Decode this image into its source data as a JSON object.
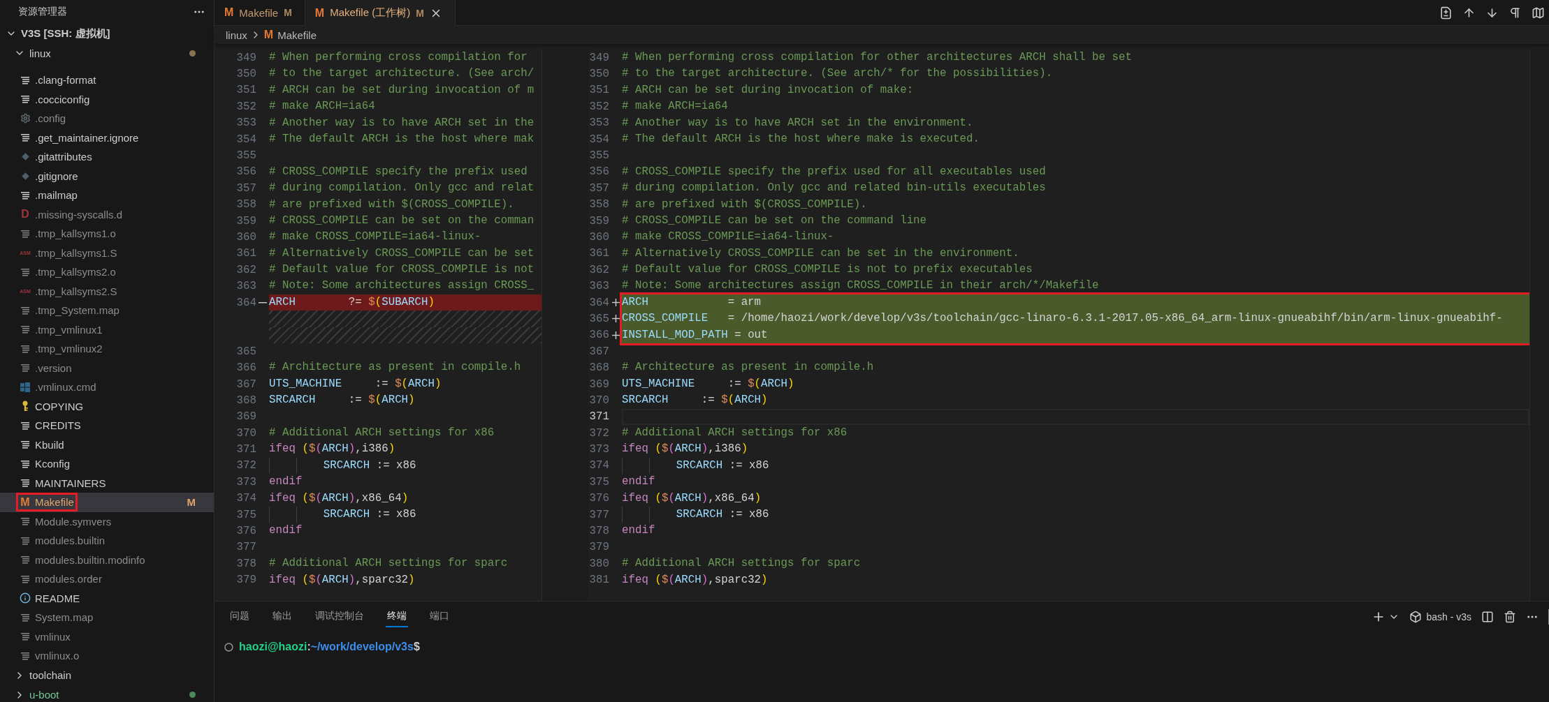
{
  "sidebar": {
    "title": "资源管理器",
    "workspace": {
      "label": "V3S [SSH: 虚拟机]",
      "expanded": true
    },
    "folders": [
      {
        "name": "linux",
        "expanded": true,
        "untracked": false,
        "color": "#8c7251",
        "files": [
          {
            "name": ".clang-format",
            "kind": "lines",
            "ignored": false,
            "modified": false,
            "selected": false,
            "annotated": false
          },
          {
            "name": ".cocciconfig",
            "kind": "lines",
            "ignored": false,
            "modified": false,
            "selected": false,
            "annotated": false
          },
          {
            "name": ".config",
            "kind": "gear",
            "ignored": true,
            "modified": false,
            "selected": false,
            "annotated": false
          },
          {
            "name": ".get_maintainer.ignore",
            "kind": "lines",
            "ignored": false,
            "modified": false,
            "selected": false,
            "annotated": false
          },
          {
            "name": ".gitattributes",
            "kind": "git",
            "ignored": false,
            "modified": false,
            "selected": false,
            "annotated": false
          },
          {
            "name": ".gitignore",
            "kind": "git",
            "ignored": false,
            "modified": false,
            "selected": false,
            "annotated": false
          },
          {
            "name": ".mailmap",
            "kind": "lines",
            "ignored": false,
            "modified": false,
            "selected": false,
            "annotated": false
          },
          {
            "name": ".missing-syscalls.d",
            "kind": "dep",
            "icon_text": "D",
            "ignored": true,
            "modified": false,
            "selected": false,
            "annotated": false
          },
          {
            "name": ".tmp_kallsyms1.o",
            "kind": "lines",
            "ignored": true,
            "modified": false,
            "selected": false,
            "annotated": false
          },
          {
            "name": ".tmp_kallsyms1.S",
            "kind": "asm",
            "icon_text": "ASM",
            "ignored": true,
            "modified": false,
            "selected": false,
            "annotated": false
          },
          {
            "name": ".tmp_kallsyms2.o",
            "kind": "lines",
            "ignored": true,
            "modified": false,
            "selected": false,
            "annotated": false
          },
          {
            "name": ".tmp_kallsyms2.S",
            "kind": "asm",
            "icon_text": "ASM",
            "ignored": true,
            "modified": false,
            "selected": false,
            "annotated": false
          },
          {
            "name": ".tmp_System.map",
            "kind": "lines",
            "ignored": true,
            "modified": false,
            "selected": false,
            "annotated": false
          },
          {
            "name": ".tmp_vmlinux1",
            "kind": "lines",
            "ignored": true,
            "modified": false,
            "selected": false,
            "annotated": false
          },
          {
            "name": ".tmp_vmlinux2",
            "kind": "lines",
            "ignored": true,
            "modified": false,
            "selected": false,
            "annotated": false
          },
          {
            "name": ".version",
            "kind": "lines",
            "ignored": true,
            "modified": false,
            "selected": false,
            "annotated": false
          },
          {
            "name": ".vmlinux.cmd",
            "kind": "windows",
            "ignored": true,
            "modified": false,
            "selected": false,
            "annotated": false
          },
          {
            "name": "COPYING",
            "kind": "key",
            "ignored": false,
            "modified": false,
            "selected": false,
            "annotated": false
          },
          {
            "name": "CREDITS",
            "kind": "lines",
            "ignored": false,
            "modified": false,
            "selected": false,
            "annotated": false
          },
          {
            "name": "Kbuild",
            "kind": "lines",
            "ignored": false,
            "modified": false,
            "selected": false,
            "annotated": false
          },
          {
            "name": "Kconfig",
            "kind": "lines",
            "ignored": false,
            "modified": false,
            "selected": false,
            "annotated": false
          },
          {
            "name": "MAINTAINERS",
            "kind": "lines",
            "ignored": false,
            "modified": false,
            "selected": false,
            "annotated": false
          },
          {
            "name": "Makefile",
            "kind": "make",
            "icon_text": "M",
            "ignored": false,
            "modified": true,
            "selected": true,
            "annotated": true,
            "badge": "M"
          },
          {
            "name": "Module.symvers",
            "kind": "lines",
            "ignored": true,
            "modified": false,
            "selected": false,
            "annotated": false
          },
          {
            "name": "modules.builtin",
            "kind": "lines",
            "ignored": true,
            "modified": false,
            "selected": false,
            "annotated": false
          },
          {
            "name": "modules.builtin.modinfo",
            "kind": "lines",
            "ignored": true,
            "modified": false,
            "selected": false,
            "annotated": false
          },
          {
            "name": "modules.order",
            "kind": "lines",
            "ignored": true,
            "modified": false,
            "selected": false,
            "annotated": false
          },
          {
            "name": "README",
            "kind": "info",
            "ignored": false,
            "modified": false,
            "selected": false,
            "annotated": false
          },
          {
            "name": "System.map",
            "kind": "lines",
            "ignored": true,
            "modified": false,
            "selected": false,
            "annotated": false
          },
          {
            "name": "vmlinux",
            "kind": "lines",
            "ignored": true,
            "modified": false,
            "selected": false,
            "annotated": false
          },
          {
            "name": "vmlinux.o",
            "kind": "lines",
            "ignored": true,
            "modified": false,
            "selected": false,
            "annotated": false
          }
        ]
      },
      {
        "name": "toolchain",
        "expanded": false,
        "untracked": false
      },
      {
        "name": "u-boot",
        "expanded": false,
        "untracked": true,
        "color": "#4b8a5a"
      }
    ]
  },
  "tabs": [
    {
      "label": "Makefile",
      "icon_text": "M",
      "badge": "M",
      "modified": true,
      "selected": false
    },
    {
      "label": "Makefile (工作树)",
      "icon_text": "M",
      "badge": "M",
      "modified": true,
      "selected": true
    }
  ],
  "breadcrumb": [
    {
      "label": "linux"
    },
    {
      "label": "Makefile",
      "icon_text": "M"
    }
  ],
  "diff": {
    "left": {
      "lines": [
        {
          "number": "349",
          "tokens": [
            {
              "text": "# When performing cross compilation for",
              "kind": "comment"
            }
          ]
        },
        {
          "number": "350",
          "tokens": [
            {
              "text": "# to the target architecture. (See arch/",
              "kind": "comment"
            }
          ]
        },
        {
          "number": "351",
          "tokens": [
            {
              "text": "# ARCH can be set during invocation of m",
              "kind": "comment"
            }
          ]
        },
        {
          "number": "352",
          "tokens": [
            {
              "text": "# make ARCH=ia64",
              "kind": "comment"
            }
          ]
        },
        {
          "number": "353",
          "tokens": [
            {
              "text": "# Another way is to have ARCH set in the",
              "kind": "comment"
            }
          ]
        },
        {
          "number": "354",
          "tokens": [
            {
              "text": "# The default ARCH is the host where mak",
              "kind": "comment"
            }
          ]
        },
        {
          "number": "355"
        },
        {
          "number": "356",
          "tokens": [
            {
              "text": "# CROSS_COMPILE specify the prefix used",
              "kind": "comment"
            }
          ]
        },
        {
          "number": "357",
          "tokens": [
            {
              "text": "# during compilation. Only gcc and relat",
              "kind": "comment"
            }
          ]
        },
        {
          "number": "358",
          "tokens": [
            {
              "text": "# are prefixed with $(CROSS_COMPILE).",
              "kind": "comment"
            }
          ]
        },
        {
          "number": "359",
          "tokens": [
            {
              "text": "# CROSS_COMPILE can be set on the comman",
              "kind": "comment"
            }
          ]
        },
        {
          "number": "360",
          "tokens": [
            {
              "text": "# make CROSS_COMPILE=ia64-linux-",
              "kind": "comment"
            }
          ]
        },
        {
          "number": "361",
          "tokens": [
            {
              "text": "# Alternatively CROSS_COMPILE can be set",
              "kind": "comment"
            }
          ]
        },
        {
          "number": "362",
          "tokens": [
            {
              "text": "# Default value for CROSS_COMPILE is not",
              "kind": "comment"
            }
          ]
        },
        {
          "number": "363",
          "tokens": [
            {
              "text": "# Note: Some architectures assign CROSS_",
              "kind": "comment"
            }
          ]
        },
        {
          "number": "364",
          "removed": true,
          "tokens": [
            {
              "text": "ARCH",
              "kind": "name"
            },
            {
              "text": "        ?= ",
              "kind": "plain"
            },
            {
              "text": "$",
              "kind": "dollar"
            },
            {
              "text": "(",
              "kind": "paren"
            },
            {
              "text": "SUBARCH",
              "kind": "name"
            },
            {
              "text": ")",
              "kind": "paren"
            }
          ]
        },
        {
          "kind": "filler"
        },
        {
          "kind": "filler"
        },
        {
          "number": "365"
        },
        {
          "number": "366",
          "tokens": [
            {
              "text": "# Architecture as present in compile.h",
              "kind": "comment"
            }
          ]
        },
        {
          "number": "367",
          "tokens": [
            {
              "text": "UTS_MACHINE",
              "kind": "name"
            },
            {
              "text": "     := ",
              "kind": "plain"
            },
            {
              "text": "$",
              "kind": "dollar"
            },
            {
              "text": "(",
              "kind": "paren"
            },
            {
              "text": "ARCH",
              "kind": "name"
            },
            {
              "text": ")",
              "kind": "paren"
            }
          ]
        },
        {
          "number": "368",
          "tokens": [
            {
              "text": "SRCARCH",
              "kind": "name"
            },
            {
              "text": "     := ",
              "kind": "plain"
            },
            {
              "text": "$",
              "kind": "dollar"
            },
            {
              "text": "(",
              "kind": "paren"
            },
            {
              "text": "ARCH",
              "kind": "name"
            },
            {
              "text": ")",
              "kind": "paren"
            }
          ]
        },
        {
          "number": "369"
        },
        {
          "number": "370",
          "tokens": [
            {
              "text": "# Additional ARCH settings for x86",
              "kind": "comment"
            }
          ]
        },
        {
          "number": "371",
          "tokens": [
            {
              "text": "ifeq ",
              "kind": "keyword"
            },
            {
              "text": "(",
              "kind": "paren"
            },
            {
              "text": "$",
              "kind": "dollar"
            },
            {
              "text": "(",
              "kind": "paren2"
            },
            {
              "text": "ARCH",
              "kind": "name"
            },
            {
              "text": ")",
              "kind": "paren2"
            },
            {
              "text": ",i386",
              "kind": "plain"
            },
            {
              "text": ")",
              "kind": "paren"
            }
          ]
        },
        {
          "number": "372",
          "tokens": [
            {
              "kind": "tab"
            },
            {
              "kind": "tab"
            },
            {
              "text": "SRCARCH",
              "kind": "name"
            },
            {
              "text": " := x86",
              "kind": "plain"
            }
          ]
        },
        {
          "number": "373",
          "tokens": [
            {
              "text": "endif",
              "kind": "keyword"
            }
          ]
        },
        {
          "number": "374",
          "tokens": [
            {
              "text": "ifeq ",
              "kind": "keyword"
            },
            {
              "text": "(",
              "kind": "paren"
            },
            {
              "text": "$",
              "kind": "dollar"
            },
            {
              "text": "(",
              "kind": "paren2"
            },
            {
              "text": "ARCH",
              "kind": "name"
            },
            {
              "text": ")",
              "kind": "paren2"
            },
            {
              "text": ",x86_64",
              "kind": "plain"
            },
            {
              "text": ")",
              "kind": "paren"
            }
          ]
        },
        {
          "number": "375",
          "tokens": [
            {
              "kind": "tab"
            },
            {
              "kind": "tab"
            },
            {
              "text": "SRCARCH",
              "kind": "name"
            },
            {
              "text": " := x86",
              "kind": "plain"
            }
          ]
        },
        {
          "number": "376",
          "tokens": [
            {
              "text": "endif",
              "kind": "keyword"
            }
          ]
        },
        {
          "number": "377"
        },
        {
          "number": "378",
          "tokens": [
            {
              "text": "# Additional ARCH settings for sparc",
              "kind": "comment"
            }
          ]
        },
        {
          "number": "379",
          "tokens": [
            {
              "text": "ifeq ",
              "kind": "keyword"
            },
            {
              "text": "(",
              "kind": "paren"
            },
            {
              "text": "$",
              "kind": "dollar"
            },
            {
              "text": "(",
              "kind": "paren2"
            },
            {
              "text": "ARCH",
              "kind": "name"
            },
            {
              "text": ")",
              "kind": "paren2"
            },
            {
              "text": ",sparc32",
              "kind": "plain"
            },
            {
              "text": ")",
              "kind": "paren"
            }
          ]
        }
      ]
    },
    "right": {
      "lines": [
        {
          "number": "349",
          "tokens": [
            {
              "text": "# When performing cross compilation for other architectures ARCH shall be set",
              "kind": "comment"
            }
          ]
        },
        {
          "number": "350",
          "tokens": [
            {
              "text": "# to the target architecture. (See arch/* for the possibilities).",
              "kind": "comment"
            }
          ]
        },
        {
          "number": "351",
          "tokens": [
            {
              "text": "# ARCH can be set during invocation of make:",
              "kind": "comment"
            }
          ]
        },
        {
          "number": "352",
          "tokens": [
            {
              "text": "# make ARCH=ia64",
              "kind": "comment"
            }
          ]
        },
        {
          "number": "353",
          "tokens": [
            {
              "text": "# Another way is to have ARCH set in the environment.",
              "kind": "comment"
            }
          ]
        },
        {
          "number": "354",
          "tokens": [
            {
              "text": "# The default ARCH is the host where make is executed.",
              "kind": "comment"
            }
          ]
        },
        {
          "number": "355"
        },
        {
          "number": "356",
          "tokens": [
            {
              "text": "# CROSS_COMPILE specify the prefix used for all executables used",
              "kind": "comment"
            }
          ]
        },
        {
          "number": "357",
          "tokens": [
            {
              "text": "# during compilation. Only gcc and related bin-utils executables",
              "kind": "comment"
            }
          ]
        },
        {
          "number": "358",
          "tokens": [
            {
              "text": "# are prefixed with $(CROSS_COMPILE).",
              "kind": "comment"
            }
          ]
        },
        {
          "number": "359",
          "tokens": [
            {
              "text": "# CROSS_COMPILE can be set on the command line",
              "kind": "comment"
            }
          ]
        },
        {
          "number": "360",
          "tokens": [
            {
              "text": "# make CROSS_COMPILE=ia64-linux-",
              "kind": "comment"
            }
          ]
        },
        {
          "number": "361",
          "tokens": [
            {
              "text": "# Alternatively CROSS_COMPILE can be set in the environment.",
              "kind": "comment"
            }
          ]
        },
        {
          "number": "362",
          "tokens": [
            {
              "text": "# Default value for CROSS_COMPILE is not to prefix executables",
              "kind": "comment"
            }
          ]
        },
        {
          "number": "363",
          "tokens": [
            {
              "text": "# Note: Some architectures assign CROSS_COMPILE in their arch/*/Makefile",
              "kind": "comment"
            }
          ]
        },
        {
          "number": "364",
          "added": true,
          "annotated": true,
          "tokens": [
            {
              "text": "ARCH",
              "kind": "name"
            },
            {
              "text": "            = arm",
              "kind": "plain"
            }
          ]
        },
        {
          "number": "365",
          "added": true,
          "annotated": true,
          "tokens": [
            {
              "text": "CROSS_COMPILE",
              "kind": "name"
            },
            {
              "text": "   = /home/haozi/work/develop/v3s/toolchain/gcc-linaro-6.3.1-2017.05-x86_64_arm-linux-gnueabihf/bin/arm-linux-gnueabihf-",
              "kind": "plain"
            }
          ]
        },
        {
          "number": "366",
          "added": true,
          "annotated": true,
          "tokens": [
            {
              "text": "INSTALL_MOD_PATH",
              "kind": "name"
            },
            {
              "text": " = out",
              "kind": "plain"
            }
          ]
        },
        {
          "number": "367"
        },
        {
          "number": "368",
          "tokens": [
            {
              "text": "# Architecture as present in compile.h",
              "kind": "comment"
            }
          ]
        },
        {
          "number": "369",
          "tokens": [
            {
              "text": "UTS_MACHINE",
              "kind": "name"
            },
            {
              "text": "     := ",
              "kind": "plain"
            },
            {
              "text": "$",
              "kind": "dollar"
            },
            {
              "text": "(",
              "kind": "paren"
            },
            {
              "text": "ARCH",
              "kind": "name"
            },
            {
              "text": ")",
              "kind": "paren"
            }
          ]
        },
        {
          "number": "370",
          "tokens": [
            {
              "text": "SRCARCH",
              "kind": "name"
            },
            {
              "text": "     := ",
              "kind": "plain"
            },
            {
              "text": "$",
              "kind": "dollar"
            },
            {
              "text": "(",
              "kind": "paren"
            },
            {
              "text": "ARCH",
              "kind": "name"
            },
            {
              "text": ")",
              "kind": "paren"
            }
          ]
        },
        {
          "number": "371",
          "current": true
        },
        {
          "number": "372",
          "tokens": [
            {
              "text": "# Additional ARCH settings for x86",
              "kind": "comment"
            }
          ]
        },
        {
          "number": "373",
          "tokens": [
            {
              "text": "ifeq ",
              "kind": "keyword"
            },
            {
              "text": "(",
              "kind": "paren"
            },
            {
              "text": "$",
              "kind": "dollar"
            },
            {
              "text": "(",
              "kind": "paren2"
            },
            {
              "text": "ARCH",
              "kind": "name"
            },
            {
              "text": ")",
              "kind": "paren2"
            },
            {
              "text": ",i386",
              "kind": "plain"
            },
            {
              "text": ")",
              "kind": "paren"
            }
          ]
        },
        {
          "number": "374",
          "tokens": [
            {
              "kind": "tab"
            },
            {
              "kind": "tab"
            },
            {
              "text": "SRCARCH",
              "kind": "name"
            },
            {
              "text": " := x86",
              "kind": "plain"
            }
          ]
        },
        {
          "number": "375",
          "tokens": [
            {
              "text": "endif",
              "kind": "keyword"
            }
          ]
        },
        {
          "number": "376",
          "tokens": [
            {
              "text": "ifeq ",
              "kind": "keyword"
            },
            {
              "text": "(",
              "kind": "paren"
            },
            {
              "text": "$",
              "kind": "dollar"
            },
            {
              "text": "(",
              "kind": "paren2"
            },
            {
              "text": "ARCH",
              "kind": "name"
            },
            {
              "text": ")",
              "kind": "paren2"
            },
            {
              "text": ",x86_64",
              "kind": "plain"
            },
            {
              "text": ")",
              "kind": "paren"
            }
          ]
        },
        {
          "number": "377",
          "tokens": [
            {
              "kind": "tab"
            },
            {
              "kind": "tab"
            },
            {
              "text": "SRCARCH",
              "kind": "name"
            },
            {
              "text": " := x86",
              "kind": "plain"
            }
          ]
        },
        {
          "number": "378",
          "tokens": [
            {
              "text": "endif",
              "kind": "keyword"
            }
          ]
        },
        {
          "number": "379"
        },
        {
          "number": "380",
          "tokens": [
            {
              "text": "# Additional ARCH settings for sparc",
              "kind": "comment"
            }
          ]
        },
        {
          "number": "381",
          "tokens": [
            {
              "text": "ifeq ",
              "kind": "keyword"
            },
            {
              "text": "(",
              "kind": "paren"
            },
            {
              "text": "$",
              "kind": "dollar"
            },
            {
              "text": "(",
              "kind": "paren2"
            },
            {
              "text": "ARCH",
              "kind": "name"
            },
            {
              "text": ")",
              "kind": "paren2"
            },
            {
              "text": ",sparc32",
              "kind": "plain"
            },
            {
              "text": ")",
              "kind": "paren"
            }
          ]
        }
      ]
    }
  },
  "panel": {
    "tabs": [
      {
        "label": "问题",
        "selected": false
      },
      {
        "label": "输出",
        "selected": false
      },
      {
        "label": "调试控制台",
        "selected": false
      },
      {
        "label": "终端",
        "selected": true
      },
      {
        "label": "端口",
        "selected": false
      }
    ],
    "terminal_name": "bash - v3s",
    "prompt": [
      {
        "text": "haozi@haozi",
        "kind": "user"
      },
      {
        "text": ":",
        "kind": "plain"
      },
      {
        "text": "~/work/develop/v3s",
        "kind": "path"
      },
      {
        "text": "$",
        "kind": "plain"
      }
    ]
  }
}
